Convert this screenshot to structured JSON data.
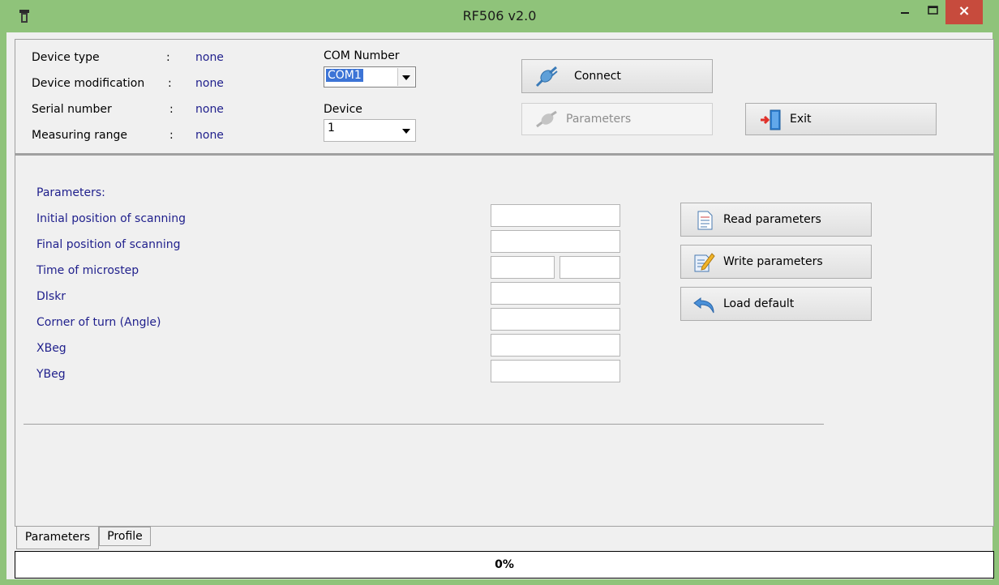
{
  "window": {
    "title": "RF506 v2.0",
    "close_glyph": "×"
  },
  "info": {
    "device_type_label": "Device type",
    "device_type_value": "none",
    "device_mod_label": "Device modification",
    "device_mod_value": "none",
    "serial_label": "Serial number",
    "serial_value": "none",
    "range_label": "Measuring range",
    "range_value": "none",
    "colon": ":"
  },
  "com": {
    "label": "COM Number",
    "value": "COM1"
  },
  "device": {
    "label": "Device",
    "value": "1"
  },
  "buttons": {
    "connect": "Connect",
    "parameters": "Parameters",
    "exit": "Exit",
    "read": "Read parameters",
    "write": "Write parameters",
    "load_default": "Load default"
  },
  "params": {
    "heading": "Parameters:",
    "initial": "Initial position of scanning",
    "final": "Final position of scanning",
    "microstep": "Time of microstep",
    "diskr": "DIskr",
    "corner": "Corner of turn (Angle)",
    "xbeg": "XBeg",
    "ybeg": "YBeg",
    "initial_value": "",
    "final_value": "",
    "microstep_value_1": "",
    "microstep_value_2": "",
    "diskr_value": "",
    "corner_value": "",
    "xbeg_value": "",
    "ybeg_value": ""
  },
  "tabs": [
    "Parameters",
    "Profile"
  ],
  "status": {
    "progress_text": "0%",
    "progress": 0
  },
  "colors": {
    "titlebar": "#8fc37a",
    "close": "#c74b3d",
    "value_text": "#1f1f8c",
    "selection": "#3c74d6"
  },
  "icons": [
    "app-icon",
    "minimize-icon",
    "maximize-icon",
    "close-icon",
    "plug-connect-icon",
    "plug-disabled-icon",
    "exit-door-icon",
    "document-list-icon",
    "document-edit-icon",
    "undo-arrow-icon",
    "dropdown-arrow-icon"
  ]
}
